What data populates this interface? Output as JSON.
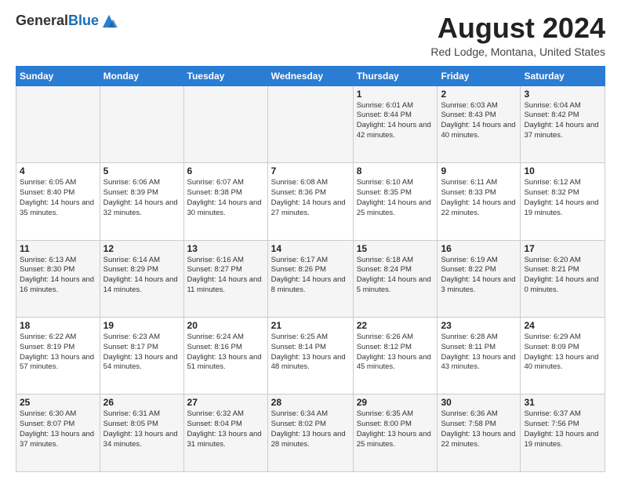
{
  "header": {
    "logo_line1": "General",
    "logo_line2": "Blue",
    "month_year": "August 2024",
    "location": "Red Lodge, Montana, United States"
  },
  "days_of_week": [
    "Sunday",
    "Monday",
    "Tuesday",
    "Wednesday",
    "Thursday",
    "Friday",
    "Saturday"
  ],
  "weeks": [
    [
      {
        "day": "",
        "info": ""
      },
      {
        "day": "",
        "info": ""
      },
      {
        "day": "",
        "info": ""
      },
      {
        "day": "",
        "info": ""
      },
      {
        "day": "1",
        "info": "Sunrise: 6:01 AM\nSunset: 8:44 PM\nDaylight: 14 hours and 42 minutes."
      },
      {
        "day": "2",
        "info": "Sunrise: 6:03 AM\nSunset: 8:43 PM\nDaylight: 14 hours and 40 minutes."
      },
      {
        "day": "3",
        "info": "Sunrise: 6:04 AM\nSunset: 8:42 PM\nDaylight: 14 hours and 37 minutes."
      }
    ],
    [
      {
        "day": "4",
        "info": "Sunrise: 6:05 AM\nSunset: 8:40 PM\nDaylight: 14 hours and 35 minutes."
      },
      {
        "day": "5",
        "info": "Sunrise: 6:06 AM\nSunset: 8:39 PM\nDaylight: 14 hours and 32 minutes."
      },
      {
        "day": "6",
        "info": "Sunrise: 6:07 AM\nSunset: 8:38 PM\nDaylight: 14 hours and 30 minutes."
      },
      {
        "day": "7",
        "info": "Sunrise: 6:08 AM\nSunset: 8:36 PM\nDaylight: 14 hours and 27 minutes."
      },
      {
        "day": "8",
        "info": "Sunrise: 6:10 AM\nSunset: 8:35 PM\nDaylight: 14 hours and 25 minutes."
      },
      {
        "day": "9",
        "info": "Sunrise: 6:11 AM\nSunset: 8:33 PM\nDaylight: 14 hours and 22 minutes."
      },
      {
        "day": "10",
        "info": "Sunrise: 6:12 AM\nSunset: 8:32 PM\nDaylight: 14 hours and 19 minutes."
      }
    ],
    [
      {
        "day": "11",
        "info": "Sunrise: 6:13 AM\nSunset: 8:30 PM\nDaylight: 14 hours and 16 minutes."
      },
      {
        "day": "12",
        "info": "Sunrise: 6:14 AM\nSunset: 8:29 PM\nDaylight: 14 hours and 14 minutes."
      },
      {
        "day": "13",
        "info": "Sunrise: 6:16 AM\nSunset: 8:27 PM\nDaylight: 14 hours and 11 minutes."
      },
      {
        "day": "14",
        "info": "Sunrise: 6:17 AM\nSunset: 8:26 PM\nDaylight: 14 hours and 8 minutes."
      },
      {
        "day": "15",
        "info": "Sunrise: 6:18 AM\nSunset: 8:24 PM\nDaylight: 14 hours and 5 minutes."
      },
      {
        "day": "16",
        "info": "Sunrise: 6:19 AM\nSunset: 8:22 PM\nDaylight: 14 hours and 3 minutes."
      },
      {
        "day": "17",
        "info": "Sunrise: 6:20 AM\nSunset: 8:21 PM\nDaylight: 14 hours and 0 minutes."
      }
    ],
    [
      {
        "day": "18",
        "info": "Sunrise: 6:22 AM\nSunset: 8:19 PM\nDaylight: 13 hours and 57 minutes."
      },
      {
        "day": "19",
        "info": "Sunrise: 6:23 AM\nSunset: 8:17 PM\nDaylight: 13 hours and 54 minutes."
      },
      {
        "day": "20",
        "info": "Sunrise: 6:24 AM\nSunset: 8:16 PM\nDaylight: 13 hours and 51 minutes."
      },
      {
        "day": "21",
        "info": "Sunrise: 6:25 AM\nSunset: 8:14 PM\nDaylight: 13 hours and 48 minutes."
      },
      {
        "day": "22",
        "info": "Sunrise: 6:26 AM\nSunset: 8:12 PM\nDaylight: 13 hours and 45 minutes."
      },
      {
        "day": "23",
        "info": "Sunrise: 6:28 AM\nSunset: 8:11 PM\nDaylight: 13 hours and 43 minutes."
      },
      {
        "day": "24",
        "info": "Sunrise: 6:29 AM\nSunset: 8:09 PM\nDaylight: 13 hours and 40 minutes."
      }
    ],
    [
      {
        "day": "25",
        "info": "Sunrise: 6:30 AM\nSunset: 8:07 PM\nDaylight: 13 hours and 37 minutes."
      },
      {
        "day": "26",
        "info": "Sunrise: 6:31 AM\nSunset: 8:05 PM\nDaylight: 13 hours and 34 minutes."
      },
      {
        "day": "27",
        "info": "Sunrise: 6:32 AM\nSunset: 8:04 PM\nDaylight: 13 hours and 31 minutes."
      },
      {
        "day": "28",
        "info": "Sunrise: 6:34 AM\nSunset: 8:02 PM\nDaylight: 13 hours and 28 minutes."
      },
      {
        "day": "29",
        "info": "Sunrise: 6:35 AM\nSunset: 8:00 PM\nDaylight: 13 hours and 25 minutes."
      },
      {
        "day": "30",
        "info": "Sunrise: 6:36 AM\nSunset: 7:58 PM\nDaylight: 13 hours and 22 minutes."
      },
      {
        "day": "31",
        "info": "Sunrise: 6:37 AM\nSunset: 7:56 PM\nDaylight: 13 hours and 19 minutes."
      }
    ]
  ]
}
